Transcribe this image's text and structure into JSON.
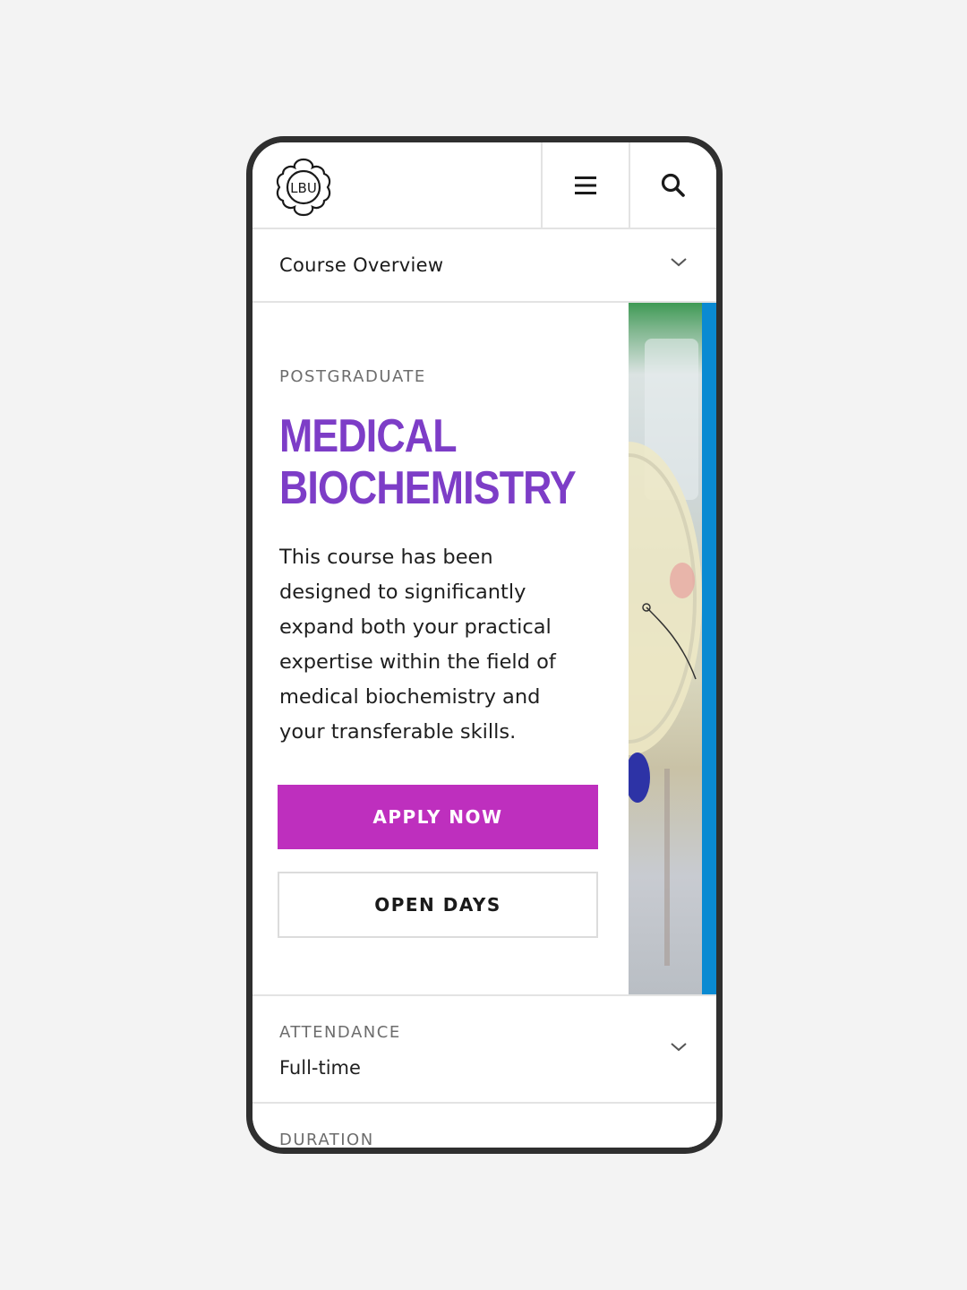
{
  "header": {
    "logo_text": "LBU",
    "menu_icon": "hamburger-menu-icon",
    "search_icon": "search-icon"
  },
  "course_nav": {
    "label": "Course Overview",
    "icon": "chevron-down-icon"
  },
  "hero": {
    "kicker": "POSTGRADUATE",
    "title_line1": "MEDICAL",
    "title_line2": "BIOCHEMISTRY",
    "description": "This course has been designed to significantly expand both your practical expertise within the field of medical biochemistry and your transferable skills.",
    "apply_label": "APPLY NOW",
    "open_days_label": "OPEN DAYS"
  },
  "details": [
    {
      "key": "ATTENDANCE",
      "value": "Full-time"
    },
    {
      "key": "DURATION"
    }
  ],
  "colors": {
    "title": "#7d3dc7",
    "apply_button": "#be2fbe",
    "accent_strip": "#0a8ad2",
    "frame": "#2f2f2f"
  }
}
